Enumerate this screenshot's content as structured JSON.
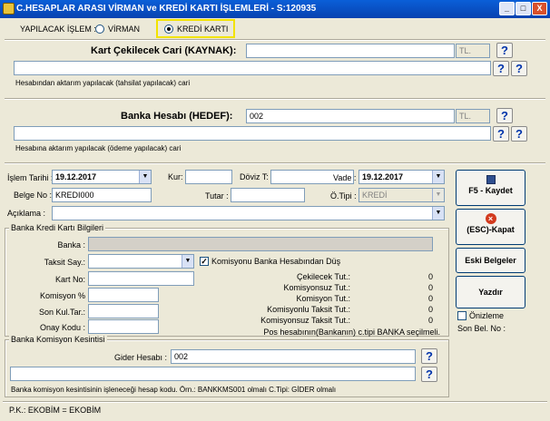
{
  "window": {
    "title": "C.HESAPLAR ARASI VİRMAN ve KREDİ KARTI İŞLEMLERİ - S:120935",
    "min": "_",
    "max": "□",
    "close": "X"
  },
  "operation": {
    "label": "YAPILACAK İŞLEM :",
    "virman": "VİRMAN",
    "kredi": "KREDİ KARTI",
    "selected": "KREDİ KARTI"
  },
  "source": {
    "title": "Kart Çekilecek Cari (KAYNAK):",
    "code": "",
    "currency": "TL.",
    "description": "",
    "note": "Hesabından aktarım yapılacak (tahsilat yapılacak) cari"
  },
  "target": {
    "title": "Banka Hesabı (HEDEF):",
    "code": "002",
    "currency": "TL.",
    "description": "",
    "note": "Hesabına aktarım yapılacak (ödeme yapılacak) cari"
  },
  "form": {
    "islem_tarihi_label": "İşlem Tarihi :",
    "islem_tarihi": "19.12.2017",
    "kur_label": "Kur:",
    "kur": "",
    "doviz_label": "Döviz T:",
    "doviz": "",
    "vade_label": "Vade :",
    "vade": "19.12.2017",
    "belge_label": "Belge No :",
    "belge": "KREDI000",
    "tutar_label": "Tutar :",
    "tutar": "",
    "otipi_label": "Ö.Tipi :",
    "otipi": "KREDİ",
    "aciklama_label": "Açıklama :",
    "aciklama": ""
  },
  "card": {
    "group_title": "Banka Kredi Kartı Bilgileri",
    "banka_label": "Banka :",
    "banka": "",
    "taksit_label": "Taksit Say.:",
    "taksit": "",
    "komisyon_check_label": "Komisyonu Banka Hesabından Düş",
    "komisyon_checked": true,
    "kartno_label": "Kart No:",
    "kartno": "",
    "komisyon_label": "Komisyon %",
    "komisyon": "",
    "sonkul_label": "Son Kul.Tar.:",
    "sonkul": "",
    "onay_label": "Onay Kodu :",
    "onay": "",
    "totals": [
      {
        "label": "Çekilecek Tut.:",
        "value": "0"
      },
      {
        "label": "Komisyonsuz Tut.:",
        "value": "0"
      },
      {
        "label": "Komisyon Tut.:",
        "value": "0"
      },
      {
        "label": "Komisyonlu Taksit Tut.:",
        "value": "0"
      },
      {
        "label": "Komisyonsuz Taksit Tut.:",
        "value": "0"
      }
    ],
    "pos_note": "Pos hesabının(Bankanın) c.tipi BANKA seçilmeli."
  },
  "commission": {
    "group_title": "Banka Komisyon Kesintisi",
    "gider_label": "Gider Hesabı :",
    "gider": "002",
    "description": "",
    "note": "Banka komisyon kesintisinin işleneceği hesap kodu. Örn.: BANKKMS001 olmalı C.Tipi: GİDER olmalı"
  },
  "buttons": {
    "save": "F5 - Kaydet",
    "close": "(ESC)-Kapat",
    "old_docs": "Eski Belgeler",
    "print": "Yazdır",
    "preview": "Önizleme",
    "last_doc": "Son Bel. No :"
  },
  "footer": {
    "status": "P.K.: EKOBİM = EKOBİM"
  },
  "icons": {
    "help": "?",
    "dropdown": "▼",
    "check": "✓"
  },
  "colors": {
    "titlebar": "#0842b0",
    "highlight": "#f2e300",
    "help": "#0033aa",
    "close_icon": "#d23a1e"
  }
}
